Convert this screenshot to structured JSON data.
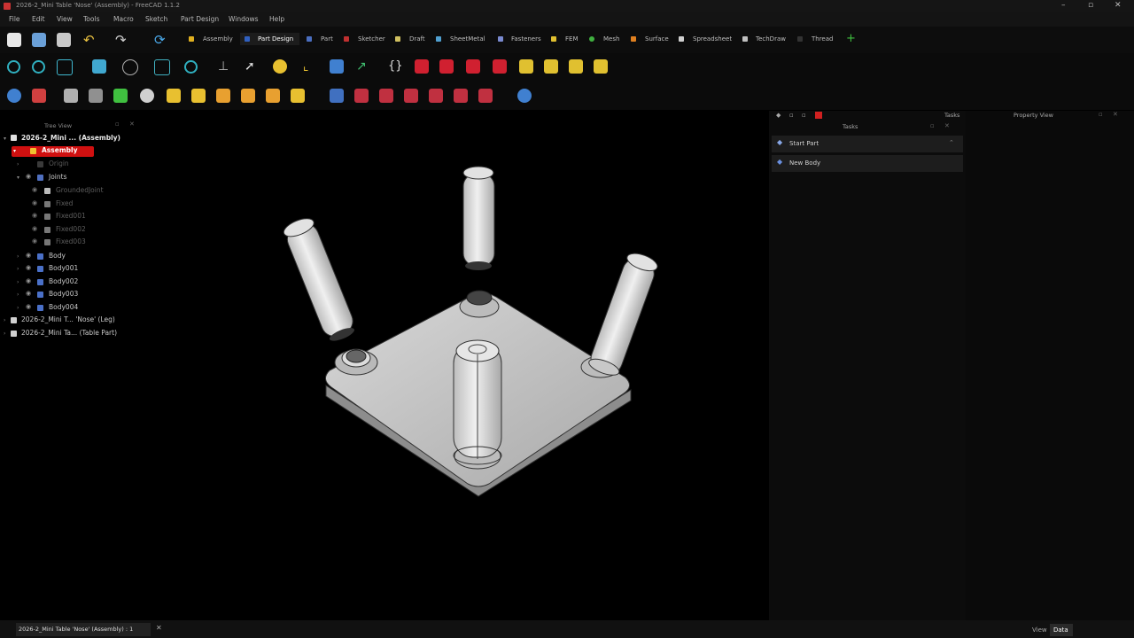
{
  "window": {
    "title": "2026-2_Mini Table 'Nose' (Assembly) - FreeCAD 1.1.2",
    "controls": [
      "minimize-icon",
      "maximize-icon",
      "close-icon"
    ]
  },
  "menu": [
    "File",
    "Edit",
    "View",
    "Tools",
    "Macro",
    "Sketch",
    "Part Design",
    "Windows",
    "Help"
  ],
  "workbenches": [
    {
      "label": "Assembly",
      "color": "#e0b020"
    },
    {
      "label": "Part Design",
      "color": "#3060c0"
    },
    {
      "label": "Part",
      "color": "#4a6ec0"
    },
    {
      "label": "Sketcher",
      "color": "#c03030"
    },
    {
      "label": "Draft",
      "color": "#d0c060"
    },
    {
      "label": "SheetMetal",
      "color": "#50a0d0"
    },
    {
      "label": "Fasteners",
      "color": "#7a8ad0"
    },
    {
      "label": "FEM",
      "color": "#e0c030"
    },
    {
      "label": "Mesh",
      "color": "#40b040"
    },
    {
      "label": "Surface",
      "color": "#e08020"
    },
    {
      "label": "Spreadsheet",
      "color": "#d0d0d0"
    },
    {
      "label": "TechDraw",
      "color": "#c0c0c0"
    },
    {
      "label": "Thread",
      "color": "#202020"
    }
  ],
  "tree": {
    "header": "Tree View",
    "items": [
      {
        "label": "2026-2_Mini ... (Assembly)",
        "bold": true
      },
      {
        "label": "Assembly",
        "selected": true
      },
      {
        "label": "Origin",
        "dim": true
      },
      {
        "label": "Joints"
      },
      {
        "label": "GroundedJoint",
        "dim": true
      },
      {
        "label": "Fixed",
        "dim": true
      },
      {
        "label": "Fixed001",
        "dim": true
      },
      {
        "label": "Fixed002",
        "dim": true
      },
      {
        "label": "Fixed003",
        "dim": true
      },
      {
        "label": "Body"
      },
      {
        "label": "Body001"
      },
      {
        "label": "Body002"
      },
      {
        "label": "Body003"
      },
      {
        "label": "Body004"
      },
      {
        "label": "2026-2_Mini T... 'Nose' (Leg)"
      },
      {
        "label": "2026-2_Mini Ta... (Table Part)"
      }
    ]
  },
  "tasks": {
    "header": "Tasks",
    "buttons": [
      "Start Part",
      "New Body"
    ]
  },
  "properties": {
    "header": "Property View"
  },
  "status": {
    "document_tab": "2026-2_Mini Table 'Nose' (Assembly) : 1",
    "tabs": [
      "View",
      "Data"
    ]
  }
}
